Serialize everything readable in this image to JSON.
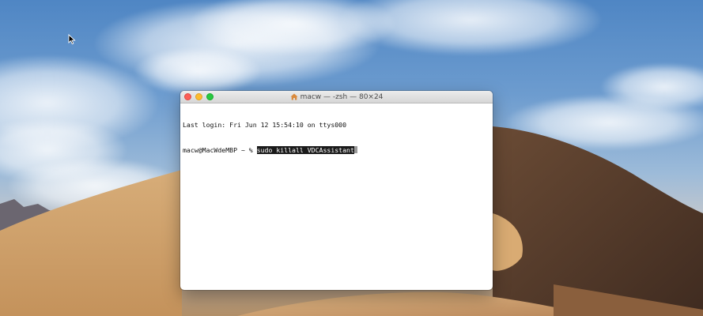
{
  "window": {
    "title": "macw — -zsh — 80×24",
    "title_icon": "home-folder-icon"
  },
  "terminal": {
    "last_login_line": "Last login: Fri Jun 12 15:54:10 on ttys000",
    "prompt": "macw@MacWdeMBP ~ % ",
    "command": "sudo killall VDCAssistant"
  },
  "colors": {
    "close": "#fc5f57",
    "minimize": "#fdbc2e",
    "zoom": "#28c840",
    "selection_bg": "#1a1a1a"
  },
  "icons": {
    "pointer": "mouse-pointer-icon",
    "traffic_lights": [
      "close-icon",
      "minimize-icon",
      "zoom-icon"
    ]
  }
}
